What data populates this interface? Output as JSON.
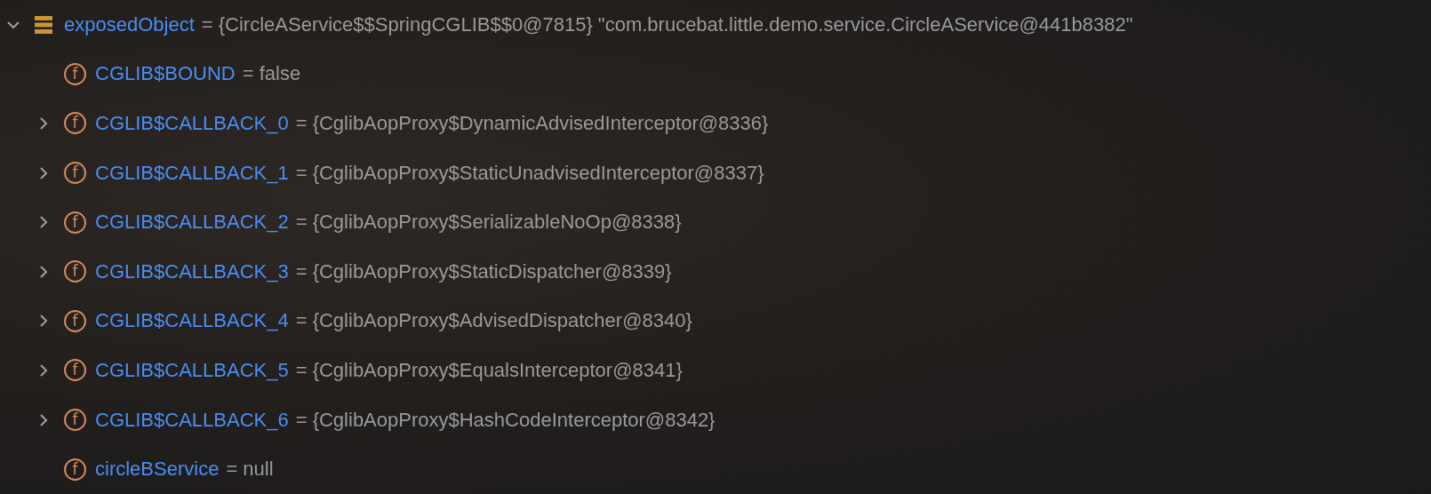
{
  "tree": [
    {
      "kind": "object",
      "name": "exposedObject",
      "value": "= {CircleAService$$SpringCGLIB$$0@7815} \"com.brucebat.little.demo.service.CircleAService@441b8382\"",
      "expandable": true,
      "expanded": true,
      "children": [
        {
          "kind": "field",
          "icon_letter": "f",
          "name": "CGLIB$BOUND",
          "value": "= false",
          "expandable": false
        },
        {
          "kind": "field",
          "icon_letter": "f",
          "name": "CGLIB$CALLBACK_0",
          "value": "= {CglibAopProxy$DynamicAdvisedInterceptor@8336}",
          "expandable": true,
          "expanded": false
        },
        {
          "kind": "field",
          "icon_letter": "f",
          "name": "CGLIB$CALLBACK_1",
          "value": "= {CglibAopProxy$StaticUnadvisedInterceptor@8337}",
          "expandable": true,
          "expanded": false
        },
        {
          "kind": "field",
          "icon_letter": "f",
          "name": "CGLIB$CALLBACK_2",
          "value": "= {CglibAopProxy$SerializableNoOp@8338}",
          "expandable": true,
          "expanded": false
        },
        {
          "kind": "field",
          "icon_letter": "f",
          "name": "CGLIB$CALLBACK_3",
          "value": "= {CglibAopProxy$StaticDispatcher@8339}",
          "expandable": true,
          "expanded": false
        },
        {
          "kind": "field",
          "icon_letter": "f",
          "name": "CGLIB$CALLBACK_4",
          "value": "= {CglibAopProxy$AdvisedDispatcher@8340}",
          "expandable": true,
          "expanded": false
        },
        {
          "kind": "field",
          "icon_letter": "f",
          "name": "CGLIB$CALLBACK_5",
          "value": "= {CglibAopProxy$EqualsInterceptor@8341}",
          "expandable": true,
          "expanded": false
        },
        {
          "kind": "field",
          "icon_letter": "f",
          "name": "CGLIB$CALLBACK_6",
          "value": "= {CglibAopProxy$HashCodeInterceptor@8342}",
          "expandable": true,
          "expanded": false
        },
        {
          "kind": "field",
          "icon_letter": "f",
          "name": "circleBService",
          "value": "= null",
          "expandable": false
        }
      ]
    }
  ]
}
